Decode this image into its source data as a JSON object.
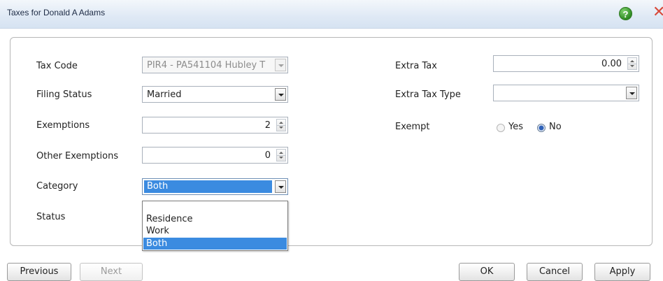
{
  "window": {
    "title": "Taxes for Donald A Adams",
    "help_glyph": "?",
    "close_glyph": "✕"
  },
  "left": {
    "tax_code": {
      "label": "Tax Code",
      "value": "PIR4 - PA541104 Hubley T"
    },
    "filing_status": {
      "label": "Filing Status",
      "value": "Married"
    },
    "exemptions": {
      "label": "Exemptions",
      "value": "2"
    },
    "other_exemptions": {
      "label": "Other Exemptions",
      "value": "0"
    },
    "category": {
      "label": "Category",
      "value": "Both",
      "options": [
        "Residence",
        "Work",
        "Both"
      ]
    },
    "status": {
      "label": "Status"
    }
  },
  "right": {
    "extra_tax": {
      "label": "Extra Tax",
      "value": "0.00"
    },
    "extra_tax_type": {
      "label": "Extra Tax Type",
      "value": ""
    },
    "exempt": {
      "label": "Exempt",
      "yes": "Yes",
      "no": "No",
      "selected": "No"
    }
  },
  "buttons": {
    "previous": "Previous",
    "next": "Next",
    "ok": "OK",
    "cancel": "Cancel",
    "apply": "Apply"
  },
  "colors": {
    "selection": "#3b8be0",
    "title_bar": "#dfe9f5"
  }
}
